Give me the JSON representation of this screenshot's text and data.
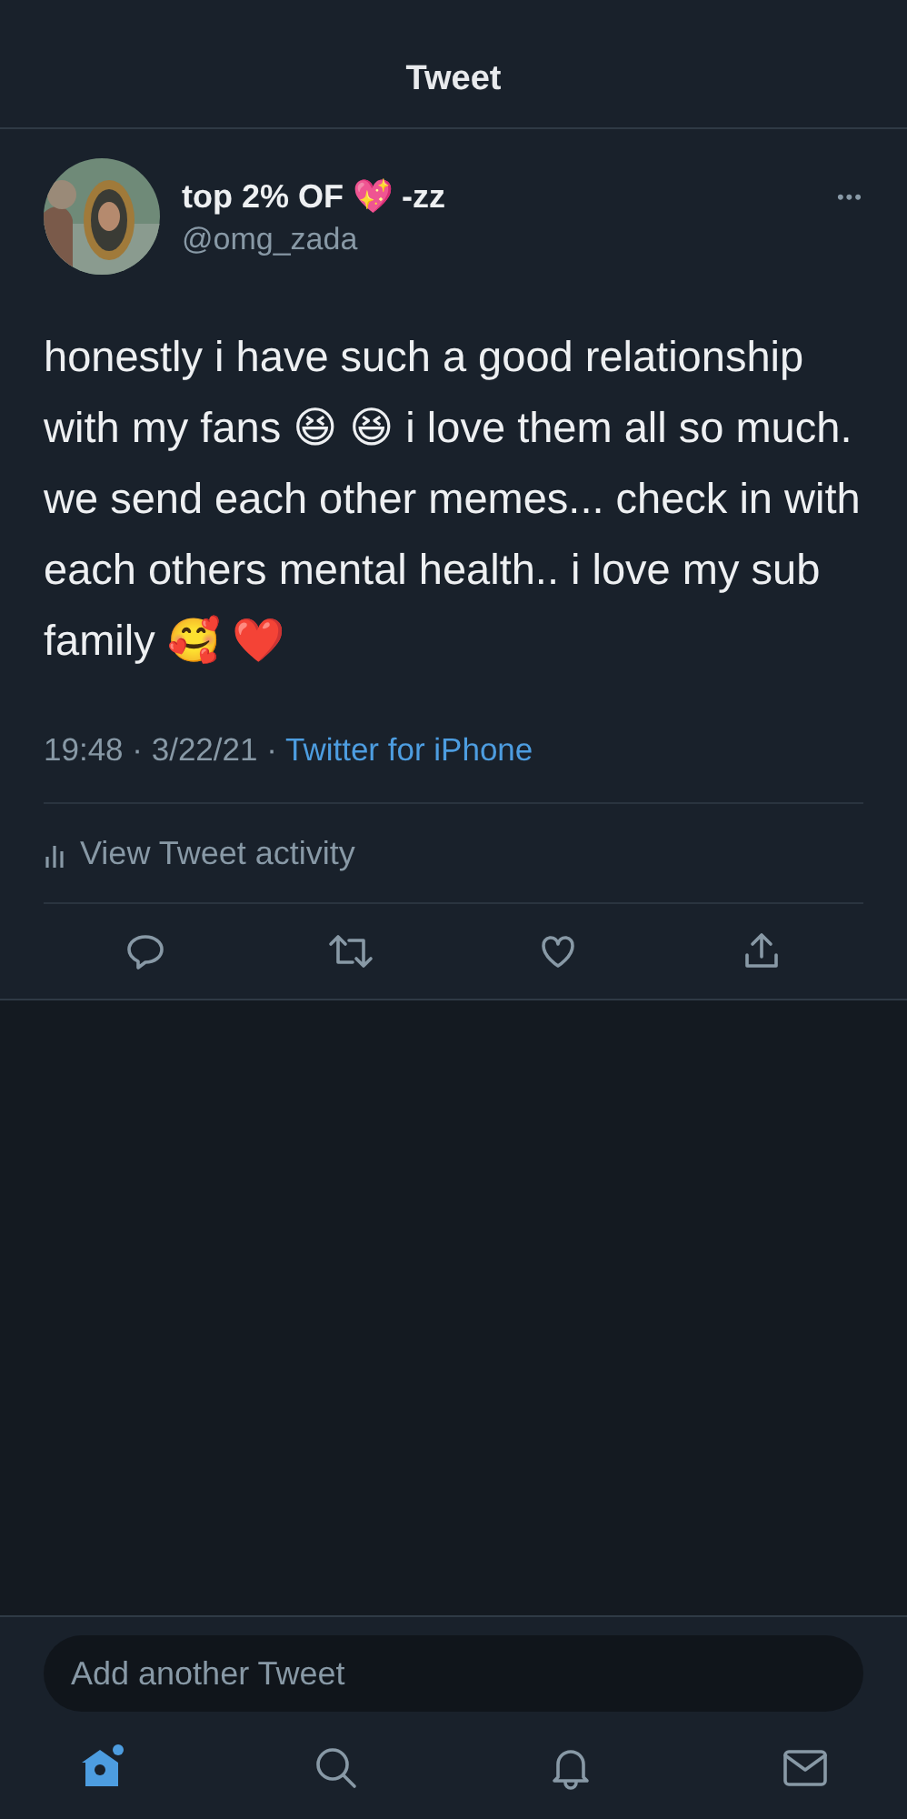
{
  "header": {
    "title": "Tweet"
  },
  "tweet": {
    "display_name": "top 2% OF 💖 -zz",
    "handle": "@omg_zada",
    "more": "•••",
    "text": "honestly i have such a good relationship with my fans 😆 😆 i love them all so much. we send each other memes... check in with each others mental health.. i love my sub family 🥰 ❤️",
    "time": "19:48 · 3/22/21 · ",
    "source": "Twitter for iPhone",
    "activity": "View Tweet activity"
  },
  "actions": [
    {
      "kind": "reply"
    },
    {
      "kind": "retweet"
    },
    {
      "kind": "like"
    },
    {
      "kind": "share"
    }
  ],
  "composer": {
    "placeholder": "Add another Tweet"
  },
  "nav": [
    {
      "kind": "home",
      "selected": true,
      "badge": true
    },
    {
      "kind": "search",
      "selected": false,
      "badge": false
    },
    {
      "kind": "notifications",
      "selected": false,
      "badge": false
    },
    {
      "kind": "messages",
      "selected": false,
      "badge": false
    }
  ]
}
